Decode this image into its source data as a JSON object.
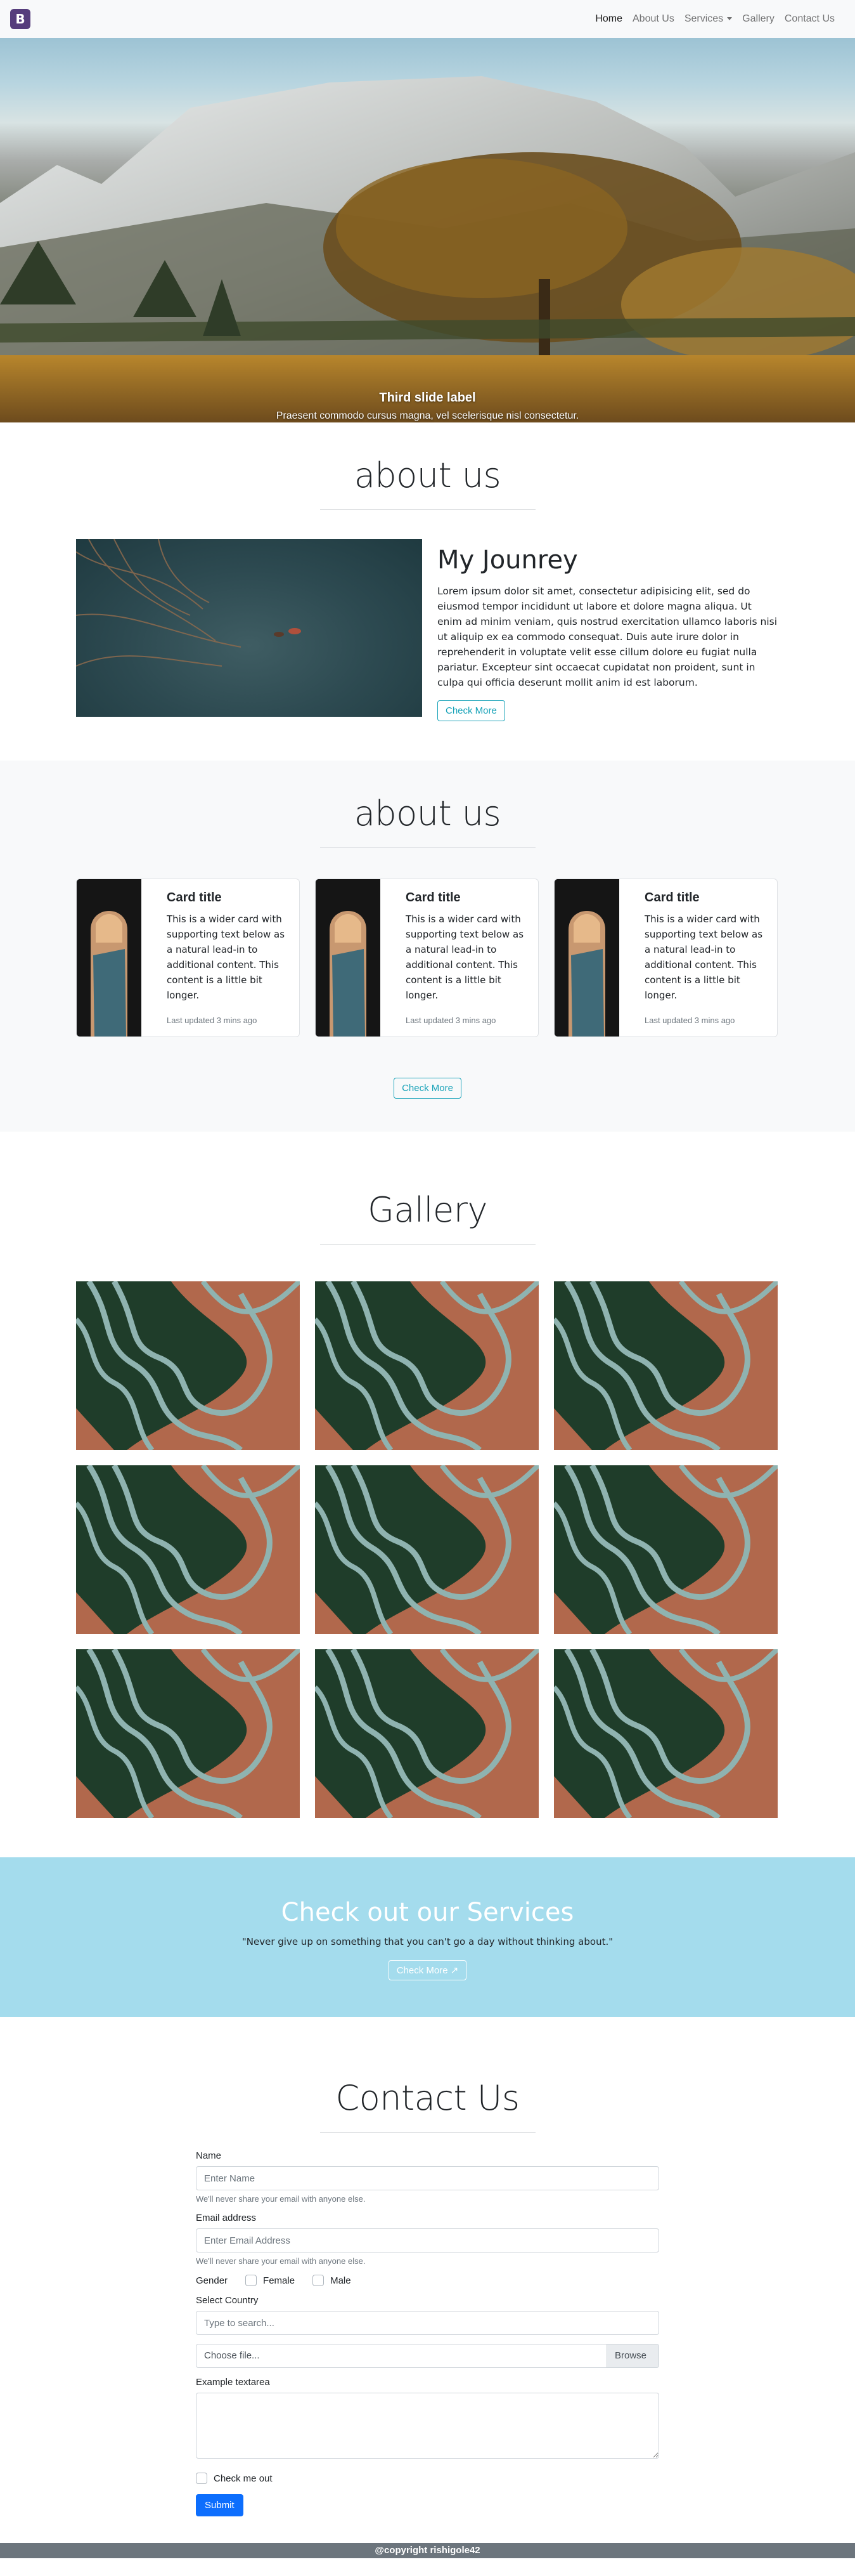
{
  "navbar": {
    "brand": "B",
    "links": [
      {
        "label": "Home",
        "active": true
      },
      {
        "label": "About Us"
      },
      {
        "label": "Services",
        "dropdown": true
      },
      {
        "label": "Gallery"
      },
      {
        "label": "Contact Us"
      }
    ]
  },
  "hero": {
    "caption_title": "Third slide label",
    "caption_text": "Praesent commodo cursus magna, vel scelerisque nisl consectetur.",
    "slides": 3,
    "active_slide": 3
  },
  "about1": {
    "title": "about us",
    "heading": "My Jounrey",
    "paragraph": "Lorem ipsum dolor sit amet, consectetur adipisicing elit, sed do eiusmod tempor incididunt ut labore et dolore magna aliqua. Ut enim ad minim veniam, quis nostrud exercitation ullamco laboris nisi ut aliquip ex ea commodo consequat. Duis aute irure dolor in reprehenderit in voluptate velit esse cillum dolore eu fugiat nulla pariatur. Excepteur sint occaecat cupidatat non proident, sunt in culpa qui officia deserunt mollit anim id est laborum.",
    "button": "Check More"
  },
  "about2": {
    "title": "about us",
    "cards": [
      {
        "title": "Card title",
        "text": "This is a wider card with supporting text below as a natural lead-in to additional content. This content is a little bit longer.",
        "updated": "Last updated 3 mins ago"
      },
      {
        "title": "Card title",
        "text": "This is a wider card with supporting text below as a natural lead-in to additional content. This content is a little bit longer.",
        "updated": "Last updated 3 mins ago"
      },
      {
        "title": "Card title",
        "text": "This is a wider card with supporting text below as a natural lead-in to additional content. This content is a little bit longer.",
        "updated": "Last updated 3 mins ago"
      }
    ],
    "button": "Check More"
  },
  "gallery": {
    "title": "Gallery",
    "image_count": 9
  },
  "services": {
    "title": "Check out our Services",
    "quote": "\"Never give up on something that you can't go a day without thinking about.\"",
    "button": "Check More"
  },
  "contact": {
    "title": "Contact Us",
    "name_label": "Name",
    "name_placeholder": "Enter Name",
    "name_help": "We'll never share your email with anyone else.",
    "email_label": "Email address",
    "email_placeholder": "Enter Email Address",
    "email_help": "We'll never share your email with anyone else.",
    "gender_label": "Gender",
    "gender_female": "Female",
    "gender_male": "Male",
    "country_label": "Select Country",
    "country_placeholder": "Type to search...",
    "file_text": "Choose file...",
    "file_button": "Browse",
    "textarea_label": "Example textarea",
    "checkbox_label": "Check me out",
    "submit": "Submit"
  },
  "footer": {
    "text": "@copyright rishigole42"
  }
}
